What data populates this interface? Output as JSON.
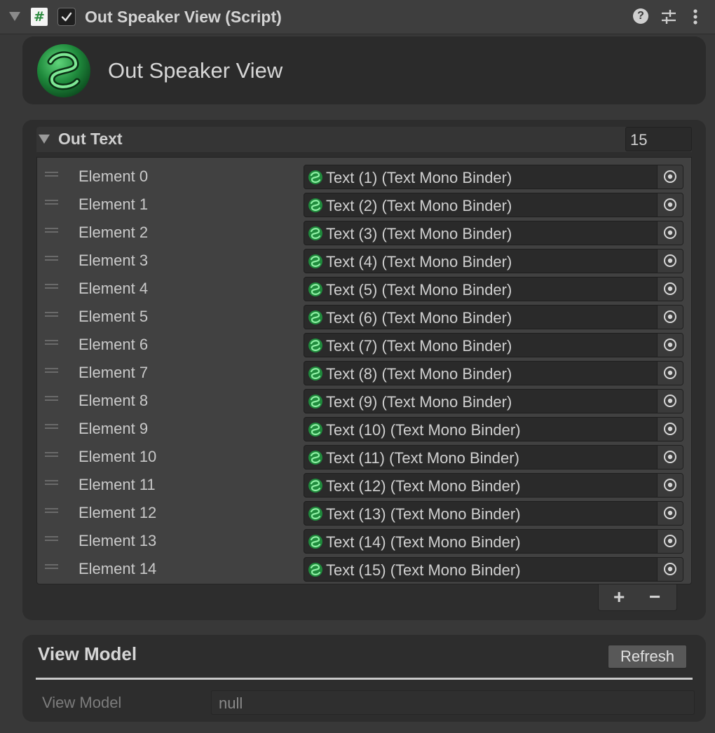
{
  "component": {
    "title": "Out Speaker View (Script)",
    "script_glyph": "#",
    "help_glyph": "?"
  },
  "banner": {
    "title": "Out Speaker View"
  },
  "out_text": {
    "label": "Out Text",
    "size": "15",
    "elements": [
      {
        "label": "Element 0",
        "value": "Text (1) (Text Mono Binder)"
      },
      {
        "label": "Element 1",
        "value": "Text (2) (Text Mono Binder)"
      },
      {
        "label": "Element 2",
        "value": "Text (3) (Text Mono Binder)"
      },
      {
        "label": "Element 3",
        "value": "Text (4) (Text Mono Binder)"
      },
      {
        "label": "Element 4",
        "value": "Text (5) (Text Mono Binder)"
      },
      {
        "label": "Element 5",
        "value": "Text (6) (Text Mono Binder)"
      },
      {
        "label": "Element 6",
        "value": "Text (7) (Text Mono Binder)"
      },
      {
        "label": "Element 7",
        "value": "Text (8) (Text Mono Binder)"
      },
      {
        "label": "Element 8",
        "value": "Text (9) (Text Mono Binder)"
      },
      {
        "label": "Element 9",
        "value": "Text (10) (Text Mono Binder)"
      },
      {
        "label": "Element 10",
        "value": "Text (11) (Text Mono Binder)"
      },
      {
        "label": "Element 11",
        "value": "Text (12) (Text Mono Binder)"
      },
      {
        "label": "Element 12",
        "value": "Text (13) (Text Mono Binder)"
      },
      {
        "label": "Element 13",
        "value": "Text (14) (Text Mono Binder)"
      },
      {
        "label": "Element 14",
        "value": "Text (15) (Text Mono Binder)"
      }
    ],
    "add_label": "+",
    "remove_label": "−"
  },
  "view_model": {
    "title": "View Model",
    "refresh_label": "Refresh",
    "field_label": "View Model",
    "field_value": "null"
  },
  "colors": {
    "accent_green": "#2fa84f",
    "background": "#383838",
    "panel": "#2d2d2d"
  },
  "icons": {
    "foldout": "triangle-down-icon",
    "script": "csharp-script-icon",
    "toggle": "checkmark-icon",
    "help": "help-icon",
    "presets": "sliders-icon",
    "menu": "kebab-menu-icon",
    "logo": "green-serpent-logo-icon",
    "object": "mono-binder-icon",
    "picker": "object-picker-icon",
    "drag": "drag-handle-icon"
  }
}
